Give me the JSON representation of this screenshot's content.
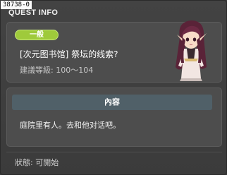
{
  "window": {
    "id_tag": "38738-0",
    "title": "QUEST INFO"
  },
  "quest": {
    "category": "一般",
    "name": "[次元图书馆] 祭坛的线索?",
    "level_label": "建議等級:",
    "level_range": "100～104",
    "portrait": "npc-portrait"
  },
  "details": {
    "header": "內容",
    "text": "庭院里有人。去和他对话吧。"
  },
  "footer": {
    "status_label": "狀態:",
    "status_value": "可開始"
  }
}
